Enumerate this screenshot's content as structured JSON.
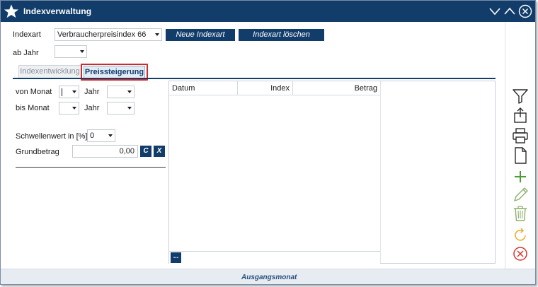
{
  "window": {
    "title": "Indexverwaltung"
  },
  "form": {
    "indexart_label": "Indexart",
    "indexart_value": "Verbraucherpreisindex 66",
    "neue_indexart": "Neue Indexart",
    "indexart_loeschen": "Indexart löschen",
    "ab_jahr_label": "ab Jahr",
    "ab_jahr_value": ""
  },
  "tabs": [
    {
      "label": "Indexentwicklung",
      "active": false
    },
    {
      "label": "Preissteigerung",
      "active": true
    }
  ],
  "left_panel": {
    "von_monat_label": "von Monat",
    "von_monat_value": "",
    "bis_monat_label": "bis Monat",
    "bis_monat_value": "",
    "jahr_label": "Jahr",
    "schwellenwert_label": "Schwellenwert in [%]",
    "schwellenwert_value": "0",
    "grundbetrag_label": "Grundbetrag",
    "grundbetrag_value": "0,00",
    "btn_c": "C",
    "btn_x": "X"
  },
  "grid": {
    "columns": [
      "Datum",
      "Index",
      "Betrag"
    ],
    "rows": [],
    "bottom_button": "..."
  },
  "footer": {
    "label": "Ausgangsmonat"
  },
  "icons": {
    "app": "star-icon",
    "toolbar": [
      "filter-icon",
      "export-icon",
      "print-icon",
      "document-icon",
      "add-icon",
      "edit-icon",
      "delete-icon",
      "refresh-icon",
      "cancel-icon"
    ]
  },
  "colors": {
    "titlebar": "#123d6b",
    "highlight": "#cc2b2b",
    "add": "#4f9a3a",
    "refresh": "#e9b233",
    "cancel": "#d6332f"
  }
}
